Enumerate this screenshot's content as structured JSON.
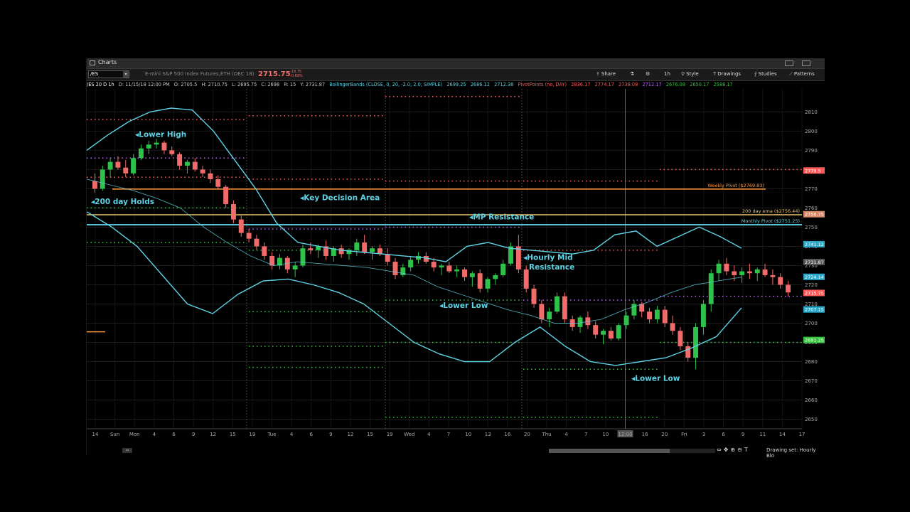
{
  "window": {
    "title": "Charts"
  },
  "toolbar": {
    "symbol": "/ES",
    "description": "E-mini S&P 500 Index Futures,ETH (DEC 18)",
    "price": "2715.75",
    "change": "-18.75",
    "change_pct": "-0.69%",
    "share": "Share",
    "timeframe": "1h",
    "style": "Style",
    "drawings": "Drawings",
    "studies": "Studies",
    "patterns": "Patterns"
  },
  "infobar": {
    "symbol": "/ES 20 D 1h",
    "date": "D: 11/15/18 12:00 PM",
    "open": "O: 2705.5",
    "high": "H: 2710.75",
    "low": "L: 2695.75",
    "close": "C: 2698",
    "range": "R: 15",
    "y": "Y: 2731.87",
    "bb_label": "BollingerBands (CLOSE, 0, 20, -2.0, 2.0, SIMPLE)",
    "bb_values": [
      "2699.25",
      "2686.12",
      "2712.38"
    ],
    "pp_label": "PivotPoints (no, DAY)",
    "pp_values": [
      "2836.17",
      "2774.17",
      "2738.08",
      "2712.17",
      "2676.08",
      "2650.17",
      "2588.17"
    ]
  },
  "colors": {
    "up": "#2ec24a",
    "down": "#f26b6b",
    "band": "#5fd3e6",
    "r_pivot": "#ff5a5a",
    "s_pivot": "#37c43f",
    "p_pivot": "#c060ff",
    "weekly": "#ff9a3c",
    "ema200": "#e8c36a",
    "monthly": "#5fd3e6",
    "annotation": "#5fd3e6"
  },
  "bottombar": {
    "drawing_set": "Drawing set: Hourly Blo"
  },
  "chart_data": {
    "type": "candlestick",
    "title": "/ES 20 D 1h",
    "ylim": [
      2645,
      2822
    ],
    "y_ticks": [
      2650,
      2660,
      2670,
      2680,
      2690,
      2700,
      2710,
      2720,
      2730,
      2740,
      2750,
      2760,
      2770,
      2780,
      2790,
      2800,
      2810
    ],
    "x_ticks": [
      "14",
      "Sun",
      "Mon",
      "4",
      "6",
      "9",
      "12",
      "15",
      "19",
      "Tue",
      "4",
      "6",
      "9",
      "12",
      "15",
      "19",
      "Wed",
      "4",
      "7",
      "10",
      "13",
      "16",
      "20",
      "Thu",
      "4",
      "7",
      "10",
      "12:00",
      "16",
      "20",
      "Fri",
      "3",
      "6",
      "9",
      "11",
      "14",
      "17"
    ],
    "current_x_label": "12:00",
    "grid": true,
    "candles": [
      [
        2774,
        2778,
        2768,
        2770
      ],
      [
        2770,
        2782,
        2769,
        2780
      ],
      [
        2780,
        2786,
        2776,
        2784
      ],
      [
        2784,
        2787,
        2780,
        2781
      ],
      [
        2781,
        2785,
        2776,
        2778
      ],
      [
        2778,
        2788,
        2777,
        2786
      ],
      [
        2786,
        2793,
        2785,
        2791
      ],
      [
        2791,
        2795,
        2788,
        2793
      ],
      [
        2793,
        2796,
        2791,
        2794
      ],
      [
        2794,
        2795,
        2788,
        2790
      ],
      [
        2790,
        2792,
        2787,
        2788
      ],
      [
        2788,
        2789,
        2780,
        2782
      ],
      [
        2782,
        2785,
        2778,
        2784
      ],
      [
        2784,
        2786,
        2779,
        2780
      ],
      [
        2780,
        2782,
        2776,
        2778
      ],
      [
        2778,
        2780,
        2773,
        2775
      ],
      [
        2775,
        2777,
        2770,
        2771
      ],
      [
        2771,
        2772,
        2760,
        2762
      ],
      [
        2762,
        2764,
        2752,
        2754
      ],
      [
        2754,
        2756,
        2745,
        2747
      ],
      [
        2747,
        2749,
        2742,
        2744
      ],
      [
        2744,
        2746,
        2738,
        2740
      ],
      [
        2740,
        2742,
        2733,
        2735
      ],
      [
        2735,
        2737,
        2728,
        2730
      ],
      [
        2730,
        2736,
        2728,
        2734
      ],
      [
        2734,
        2735,
        2726,
        2728
      ],
      [
        2728,
        2732,
        2724,
        2730
      ],
      [
        2730,
        2741,
        2729,
        2739
      ],
      [
        2739,
        2742,
        2736,
        2738
      ],
      [
        2738,
        2741,
        2734,
        2740
      ],
      [
        2740,
        2743,
        2733,
        2735
      ],
      [
        2735,
        2740,
        2732,
        2739
      ],
      [
        2739,
        2741,
        2734,
        2736
      ],
      [
        2736,
        2739,
        2733,
        2738
      ],
      [
        2738,
        2744,
        2735,
        2742
      ],
      [
        2742,
        2746,
        2736,
        2737
      ],
      [
        2737,
        2740,
        2733,
        2739
      ],
      [
        2739,
        2741,
        2735,
        2736
      ],
      [
        2736,
        2739,
        2730,
        2732
      ],
      [
        2732,
        2734,
        2723,
        2725
      ],
      [
        2725,
        2731,
        2724,
        2729
      ],
      [
        2729,
        2735,
        2727,
        2733
      ],
      [
        2733,
        2737,
        2731,
        2735
      ],
      [
        2735,
        2737,
        2731,
        2732
      ],
      [
        2732,
        2734,
        2727,
        2729
      ],
      [
        2729,
        2731,
        2725,
        2730
      ],
      [
        2730,
        2732,
        2726,
        2727
      ],
      [
        2727,
        2730,
        2724,
        2728
      ],
      [
        2728,
        2729,
        2722,
        2724
      ],
      [
        2724,
        2727,
        2719,
        2726
      ],
      [
        2726,
        2728,
        2716,
        2718
      ],
      [
        2718,
        2724,
        2716,
        2723
      ],
      [
        2723,
        2726,
        2720,
        2725
      ],
      [
        2725,
        2733,
        2724,
        2731
      ],
      [
        2731,
        2742,
        2730,
        2740
      ],
      [
        2740,
        2746,
        2726,
        2728
      ],
      [
        2728,
        2730,
        2716,
        2718
      ],
      [
        2718,
        2720,
        2708,
        2710
      ],
      [
        2710,
        2712,
        2700,
        2702
      ],
      [
        2702,
        2708,
        2698,
        2706
      ],
      [
        2706,
        2716,
        2705,
        2714
      ],
      [
        2714,
        2716,
        2700,
        2702
      ],
      [
        2702,
        2704,
        2696,
        2698
      ],
      [
        2698,
        2704,
        2695,
        2703
      ],
      [
        2703,
        2706,
        2697,
        2699
      ],
      [
        2699,
        2701,
        2692,
        2694
      ],
      [
        2694,
        2697,
        2689,
        2696
      ],
      [
        2696,
        2698,
        2691,
        2692
      ],
      [
        2692,
        2700,
        2691,
        2699
      ],
      [
        2699,
        2706,
        2697,
        2704
      ],
      [
        2704,
        2712,
        2702,
        2710
      ],
      [
        2710,
        2711,
        2703,
        2706
      ],
      [
        2706,
        2708,
        2700,
        2702
      ],
      [
        2702,
        2709,
        2700,
        2707
      ],
      [
        2707,
        2709,
        2698,
        2700
      ],
      [
        2700,
        2704,
        2694,
        2696
      ],
      [
        2696,
        2698,
        2686,
        2688
      ],
      [
        2688,
        2690,
        2680,
        2682
      ],
      [
        2682,
        2700,
        2676,
        2698
      ],
      [
        2698,
        2712,
        2694,
        2710
      ],
      [
        2710,
        2728,
        2706,
        2726
      ],
      [
        2726,
        2733,
        2722,
        2731
      ],
      [
        2731,
        2734,
        2725,
        2727
      ],
      [
        2727,
        2730,
        2722,
        2725
      ],
      [
        2725,
        2729,
        2721,
        2727
      ],
      [
        2727,
        2731,
        2723,
        2726
      ],
      [
        2726,
        2729,
        2722,
        2728
      ],
      [
        2728,
        2731,
        2724,
        2725
      ],
      [
        2725,
        2728,
        2720,
        2724
      ],
      [
        2724,
        2726,
        2718,
        2720
      ],
      [
        2720,
        2722,
        2714,
        2716
      ]
    ],
    "bollinger_upper": [
      2790,
      2798,
      2805,
      2810,
      2812,
      2811,
      2800,
      2785,
      2770,
      2752,
      2742,
      2740,
      2738,
      2737,
      2736,
      2735,
      2734,
      2732,
      2740,
      2742,
      2739,
      2738,
      2737,
      2736,
      2738,
      2746,
      2748,
      2740,
      2745,
      2750,
      2745,
      2739
    ],
    "bollinger_middle": [
      2775,
      2772,
      2769,
      2765,
      2760,
      2750,
      2742,
      2735,
      2730,
      2732,
      2731,
      2730,
      2729,
      2727,
      2725,
      2719,
      2715,
      2711,
      2707,
      2704,
      2700,
      2700,
      2702,
      2707,
      2711,
      2716,
      2720,
      2722,
      2724
    ],
    "bollinger_lower": [
      2758,
      2750,
      2740,
      2725,
      2710,
      2705,
      2715,
      2722,
      2723,
      2720,
      2716,
      2710,
      2700,
      2690,
      2684,
      2680,
      2680,
      2690,
      2698,
      2688,
      2680,
      2678,
      2680,
      2682,
      2687,
      2693,
      2708
    ],
    "levels": [
      {
        "name": "Weekly Pivot ($2769.83)",
        "value": 2769.83
      },
      {
        "name": "200 day ema ($2756.44)",
        "value": 2756.44
      },
      {
        "name": "Monthly Pivot ($2751.25)",
        "value": 2751.25
      }
    ],
    "price_tags": [
      {
        "text": "2779.5",
        "value": 2779.5,
        "color": "#ff5a5a"
      },
      {
        "text": "2756.75",
        "value": 2756.75,
        "color": "#d9896a"
      },
      {
        "text": "2741.12",
        "value": 2741.12,
        "color": "#2aa8c8"
      },
      {
        "text": "2731.87",
        "value": 2731.87,
        "color": "#555555"
      },
      {
        "text": "2724.14",
        "value": 2724.14,
        "color": "#2aa8c8"
      },
      {
        "text": "2715.75",
        "value": 2715.75,
        "color": "#ff5a5a"
      },
      {
        "text": "2707.15",
        "value": 2707.15,
        "color": "#2aa8c8"
      },
      {
        "text": "2691.25",
        "value": 2691.25,
        "color": "#37c43f"
      }
    ],
    "annotations": [
      "Lower High",
      "200 day Holds",
      "Key Decision Area",
      "MP Resistance",
      "Hourly Mid",
      "Resistance",
      "Lower Low",
      "Lower Low"
    ]
  }
}
